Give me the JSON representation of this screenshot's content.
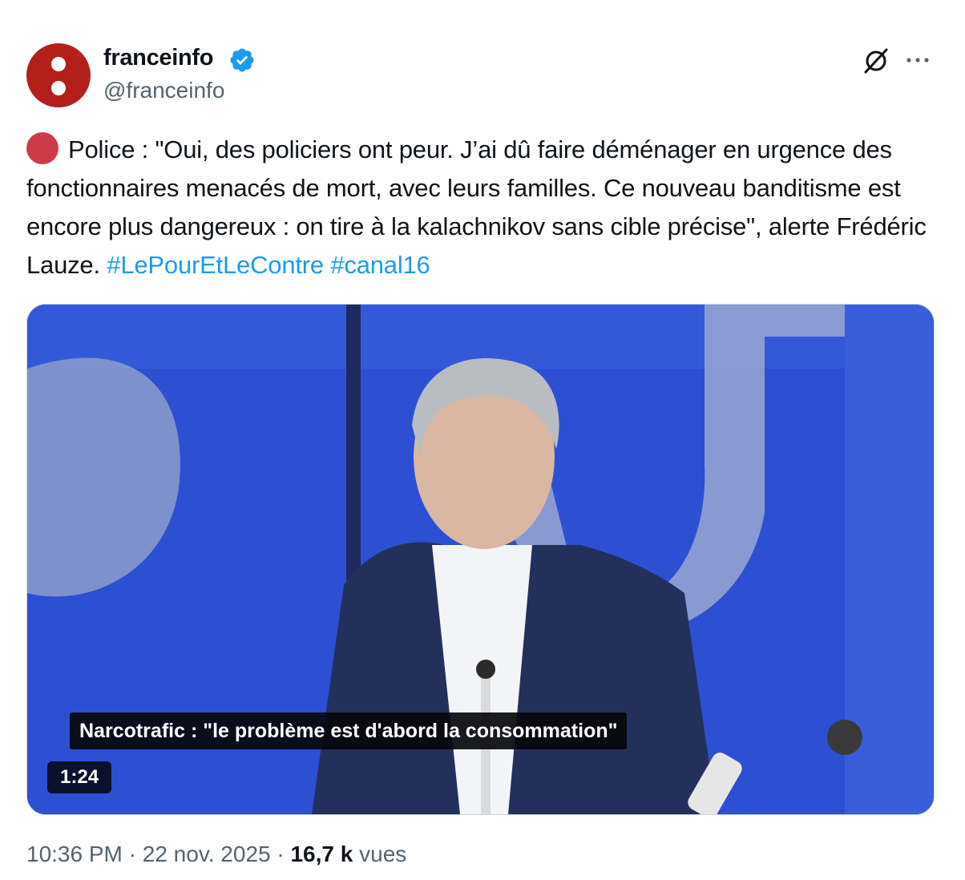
{
  "author": {
    "display_name": "franceinfo",
    "handle": "@franceinfo",
    "avatar_color": "#b3201c",
    "verified_color": "#1d9bf0"
  },
  "header_icons": [
    "grok-icon",
    "more-icon"
  ],
  "tweet": {
    "text": "Police : \"Oui, des policiers ont peur. J’ai dû faire déménager en urgence des fonctionnaires menacés de mort, avec leurs familles. Ce nouveau banditisme est encore plus dangereux : on tire à la kalachnikov sans cible précise\", alerte Frédéric Lauze.",
    "hashtags": [
      "#LePourEtLeContre",
      "#canal16"
    ],
    "hashtag_color": "#1d9bf0"
  },
  "video": {
    "subtitle": "Narcotrafic : \"le problème est d'abord la consommation\"",
    "duration": "1:24",
    "background_color": "#2d4fd2"
  },
  "meta": {
    "time": "10:36 PM",
    "separator": "·",
    "date": "22 nov. 2025",
    "views_count": "16,7 k",
    "views_label": "vues"
  }
}
